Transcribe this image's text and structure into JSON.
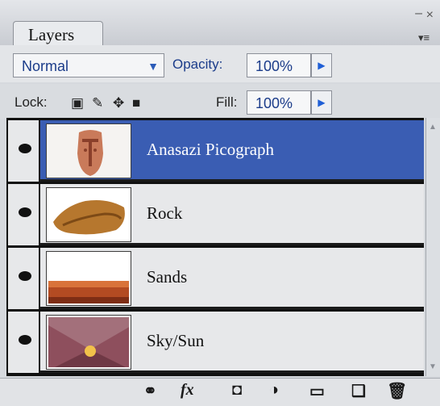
{
  "panel": {
    "tab_label": "Layers",
    "minimize_glyph": "–",
    "close_glyph": "×",
    "menu_glyph": "▾≡"
  },
  "controls": {
    "blend_mode": "Normal",
    "opacity_label": "Opacity:",
    "opacity_value": "100%",
    "lock_label": "Lock:",
    "fill_label": "Fill:",
    "fill_value": "100%"
  },
  "layers": [
    {
      "name": "Anasazi Picograph",
      "selected": true,
      "visible": true,
      "thumb": "pictograph"
    },
    {
      "name": "Rock",
      "selected": false,
      "visible": true,
      "thumb": "rock"
    },
    {
      "name": "Sands",
      "selected": false,
      "visible": true,
      "thumb": "sands"
    },
    {
      "name": "Sky/Sun",
      "selected": false,
      "visible": true,
      "thumb": "sky-sun"
    }
  ],
  "toolbar": {
    "link_glyph": "⚭",
    "fx_label": "fx",
    "mask_glyph": "◘",
    "adjust_glyph": "◑",
    "group_glyph": "▭",
    "new_glyph": "❑",
    "trash_glyph": "🗑"
  },
  "colors": {
    "selection": "#3a5db3",
    "control_text": "#1b3c8a"
  }
}
